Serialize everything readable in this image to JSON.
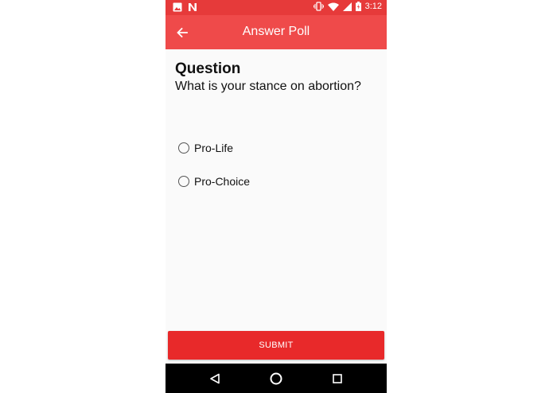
{
  "status_bar": {
    "time": "3:12",
    "left_icons": [
      "image-icon",
      "n-notification-icon"
    ],
    "right_icons": [
      "vibrate-icon",
      "wifi-icon",
      "cell-signal-icon",
      "battery-charging-icon"
    ]
  },
  "app_bar": {
    "title": "Answer Poll",
    "back_icon": "arrow-left-icon"
  },
  "question": {
    "heading": "Question",
    "text": "What is your stance on abortion?"
  },
  "options": [
    {
      "label": "Pro-Life",
      "selected": false
    },
    {
      "label": "Pro-Choice",
      "selected": false
    }
  ],
  "submit": {
    "label": "SUBMIT"
  },
  "nav_bar": {
    "icons": [
      "back-triangle-icon",
      "home-circle-icon",
      "recents-square-icon"
    ]
  },
  "colors": {
    "status_bar": "#e63a3a",
    "app_bar": "#ef4a4a",
    "submit": "#e8292a",
    "background": "#fafafa"
  }
}
